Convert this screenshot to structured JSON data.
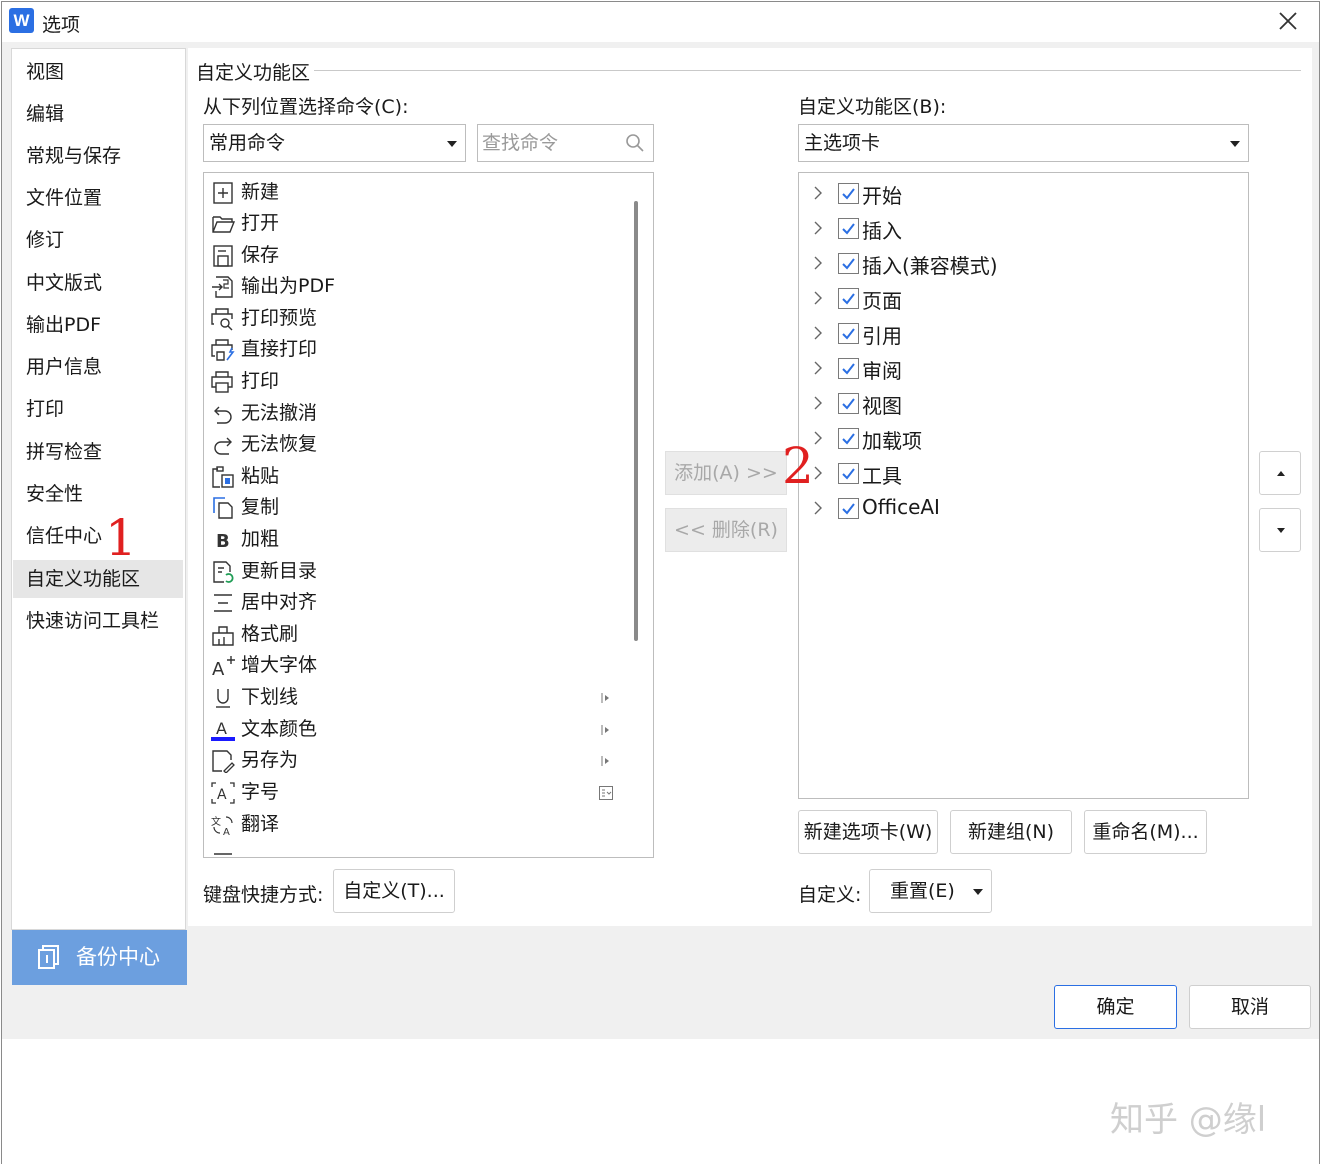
{
  "window": {
    "title": "选项",
    "app_icon_letter": "W"
  },
  "sidebar": {
    "items": [
      "视图",
      "编辑",
      "常规与保存",
      "文件位置",
      "修订",
      "中文版式",
      "输出PDF",
      "用户信息",
      "打印",
      "拼写检查",
      "安全性",
      "信任中心",
      "自定义功能区",
      "快速访问工具栏"
    ],
    "active": "自定义功能区",
    "backup_label": "备份中心"
  },
  "section_title": "自定义功能区",
  "left": {
    "choose_label": "从下列位置选择命令(C):",
    "source_value": "常用命令",
    "search_placeholder": "查找命令",
    "commands": [
      {
        "label": "新建",
        "icon": "new-doc-icon"
      },
      {
        "label": "打开",
        "icon": "folder-open-icon"
      },
      {
        "label": "保存",
        "icon": "save-icon"
      },
      {
        "label": "输出为PDF",
        "icon": "export-pdf-icon"
      },
      {
        "label": "打印预览",
        "icon": "print-preview-icon"
      },
      {
        "label": "直接打印",
        "icon": "direct-print-icon"
      },
      {
        "label": "打印",
        "icon": "printer-icon"
      },
      {
        "label": "无法撤消",
        "icon": "undo-icon"
      },
      {
        "label": "无法恢复",
        "icon": "redo-icon"
      },
      {
        "label": "粘贴",
        "icon": "paste-icon"
      },
      {
        "label": "复制",
        "icon": "copy-icon"
      },
      {
        "label": "加粗",
        "icon": "bold-icon"
      },
      {
        "label": "更新目录",
        "icon": "update-toc-icon"
      },
      {
        "label": "居中对齐",
        "icon": "align-center-icon"
      },
      {
        "label": "格式刷",
        "icon": "format-painter-icon"
      },
      {
        "label": "增大字体",
        "icon": "grow-font-icon"
      },
      {
        "label": "下划线",
        "icon": "underline-icon"
      },
      {
        "label": "文本颜色",
        "icon": "text-color-icon"
      },
      {
        "label": "另存为",
        "icon": "save-as-icon"
      },
      {
        "label": "字号",
        "icon": "font-size-icon"
      },
      {
        "label": "翻译",
        "icon": "translate-icon"
      }
    ],
    "keyboard_label": "键盘快捷方式:",
    "keyboard_button": "自定义(T)..."
  },
  "middle": {
    "add_button": "添加(A) >>",
    "remove_button": "<< 删除(R)"
  },
  "right": {
    "ribbon_label": "自定义功能区(B):",
    "ribbon_value": "主选项卡",
    "tabs": [
      {
        "label": "开始",
        "checked": true
      },
      {
        "label": "插入",
        "checked": true
      },
      {
        "label": "插入(兼容模式)",
        "checked": true
      },
      {
        "label": "页面",
        "checked": true
      },
      {
        "label": "引用",
        "checked": true
      },
      {
        "label": "审阅",
        "checked": true
      },
      {
        "label": "视图",
        "checked": true
      },
      {
        "label": "加载项",
        "checked": true
      },
      {
        "label": "工具",
        "checked": true
      },
      {
        "label": "OfficeAI",
        "checked": true
      }
    ],
    "new_tab_button": "新建选项卡(W)",
    "new_group_button": "新建组(N)",
    "rename_button": "重命名(M)...",
    "customize_label": "自定义:",
    "reset_button": "重置(E)"
  },
  "footer": {
    "ok_button": "确定",
    "cancel_button": "取消"
  },
  "annotations": {
    "step1": "1",
    "step2": "2"
  },
  "watermark": "知乎 @缘l",
  "colors": {
    "accent": "#2b6fe3",
    "backup_bg": "#6c9fdf",
    "annotation": "#e02020",
    "text_color_bar": "#1a1aff"
  }
}
